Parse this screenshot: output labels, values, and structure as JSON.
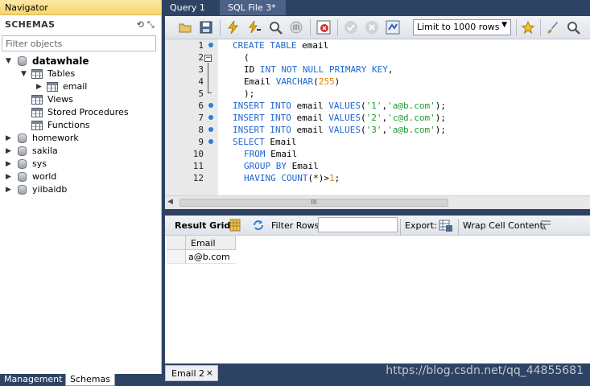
{
  "navigator": {
    "title": "Navigator",
    "schemas_header": "SCHEMAS",
    "header_icons": "⟲ ⤡",
    "filter_placeholder": "Filter objects",
    "tree": {
      "db1": "datawhale",
      "tables": "Tables",
      "table1": "email",
      "views": "Views",
      "procs": "Stored Procedures",
      "funcs": "Functions",
      "db2": "homework",
      "db3": "sakila",
      "db4": "sys",
      "db5": "world",
      "db6": "yiibaidb"
    },
    "bottom_tabs": {
      "management": "Management",
      "schemas": "Schemas"
    }
  },
  "editor_tabs": {
    "query1": "Query 1",
    "sql_file": "SQL File 3*"
  },
  "toolbar": {
    "limit_rows": "Limit to 1000 rows"
  },
  "editor": {
    "line_numbers": [
      "1",
      "2",
      "3",
      "4",
      "5",
      "6",
      "7",
      "8",
      "9",
      "10",
      "11",
      "12"
    ],
    "lines": [
      [
        "CREATE TABLE email"
      ],
      [
        "("
      ],
      [
        "ID INT NOT NULL PRIMARY KEY,"
      ],
      [
        "Email VARCHAR(255)"
      ],
      [
        ");"
      ],
      [
        "INSERT INTO email VALUES('1','a@b.com');"
      ],
      [
        "INSERT INTO email VALUES('2','c@d.com');"
      ],
      [
        "INSERT INTO email VALUES('3','a@b.com');"
      ],
      [
        "SELECT Email"
      ],
      [
        "FROM Email"
      ],
      [
        "GROUP BY Email"
      ],
      [
        "HAVING COUNT(*)>1;"
      ]
    ],
    "scroll_grip": "III"
  },
  "result_toolbar": {
    "result_grid": "Result Grid",
    "filter_rows": "Filter Rows:",
    "export": "Export:",
    "wrap_cell": "Wrap Cell Content:"
  },
  "result_grid": {
    "columns": [
      "Email"
    ],
    "rows": [
      [
        "a@b.com"
      ]
    ]
  },
  "bottom": {
    "result_tab": "Email 2",
    "close": "×",
    "watermark": "https://blog.csdn.net/qq_44855681"
  }
}
